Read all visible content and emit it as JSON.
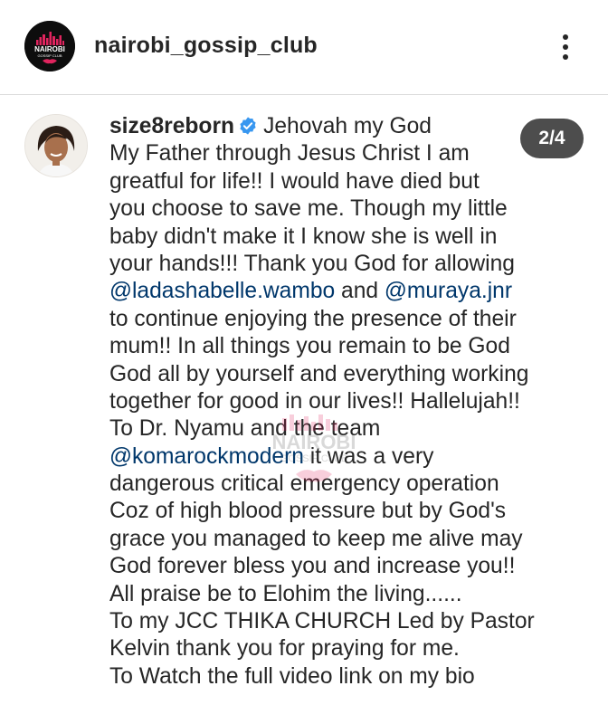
{
  "header": {
    "username": "nairobi_gossip_club",
    "logo_text_top": "NAIROBI",
    "logo_text_bottom": "GOSSIP CLUB"
  },
  "post": {
    "author": "size8reborn",
    "slide_counter": "2/4",
    "caption_lines": [
      {
        "text": "Jehovah my God"
      },
      {
        "text": "My Father through Jesus Christ I am"
      },
      {
        "text": "greatful for life!! I would have died but"
      },
      {
        "text": "you choose to save me. Though my little"
      },
      {
        "text": "baby didn't make it I know she is well in"
      },
      {
        "text": "your hands!!! Thank you God for allowing"
      },
      {
        "mention1": "@ladashabelle.wambo",
        "mid": " and ",
        "mention2": "@muraya.jnr"
      },
      {
        "text": "to continue enjoying the presence of their"
      },
      {
        "text": "mum!! In all things you remain to be God"
      },
      {
        "text": "God all by yourself and everything working"
      },
      {
        "text": "together for good in our lives!! Hallelujah!!"
      },
      {
        "text": "To Dr. Nyamu and the team"
      },
      {
        "mention1": "@komarockmodern",
        "mid": " it was a very"
      },
      {
        "text": "dangerous critical emergency operation"
      },
      {
        "text": "Coz of high blood pressure but by God's"
      },
      {
        "text": "grace you managed to keep me alive may"
      },
      {
        "text": "God forever bless you and increase you!!"
      },
      {
        "text": "All praise be to Elohim the living......"
      },
      {
        "text": "To my JCC THIKA CHURCH Led by Pastor"
      },
      {
        "text": "Kelvin thank you for praying for me."
      },
      {
        "text": "To Watch the full video link on my bio"
      }
    ]
  },
  "watermark": {
    "top": "NAIROBI",
    "bottom": "GOSSIP CLUB"
  },
  "colors": {
    "text": "#262626",
    "mention": "#00376b",
    "verified": "#3897f0",
    "logo_bg": "#0d0d0d",
    "logo_accent": "#e0245e"
  },
  "icons": {
    "verified": "verified-badge-icon",
    "more": "three-dots-vertical-icon"
  }
}
